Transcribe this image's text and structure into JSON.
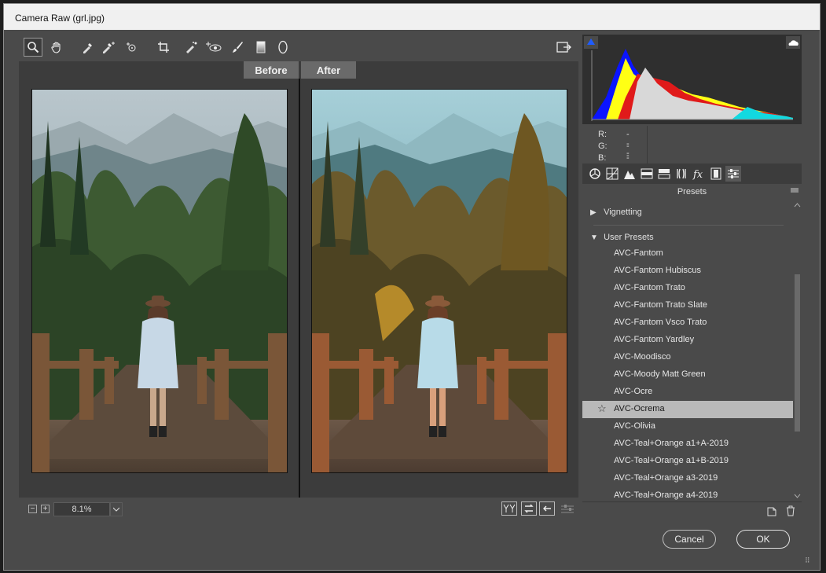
{
  "window": {
    "title": "Camera Raw (grl.jpg)"
  },
  "toolbar": {
    "tools": [
      "zoom-icon",
      "hand-icon",
      "white-balance-icon",
      "color-sampler-icon",
      "targeted-adjustment-icon",
      "crop-icon",
      "spot-removal-icon",
      "red-eye-icon",
      "adjustment-brush-icon",
      "graduated-filter-icon",
      "radial-filter-icon"
    ],
    "export_icon": "open-preferences-icon"
  },
  "preview": {
    "before_label": "Before",
    "after_label": "After"
  },
  "previewbar": {
    "zoom_out": "−",
    "zoom_in": "+",
    "zoom_value": "8.1%"
  },
  "histogram": {
    "r_label": "R:",
    "r_value": "---",
    "g_label": "G:",
    "g_value": "---",
    "b_label": "B:",
    "b_value": "---"
  },
  "panel_tabs": [
    "basic-icon",
    "tone-curve-icon",
    "detail-icon",
    "hsl-icon",
    "split-toning-icon",
    "lens-corrections-icon",
    "effects-icon",
    "camera-calibration-icon",
    "presets-icon"
  ],
  "presets": {
    "header": "Presets",
    "groups": [
      {
        "label": "Vignetting",
        "expanded": false
      },
      {
        "label": "User Presets",
        "expanded": true
      }
    ],
    "items": [
      "AVC-Fantom",
      "AVC-Fantom Hubiscus",
      "AVC-Fantom Trato",
      "AVC-Fantom Trato Slate",
      "AVC-Fantom Vsco Trato",
      "AVC-Fantom Yardley",
      "AVC-Moodisco",
      "AVC-Moody Matt Green",
      "AVC-Ocre",
      "AVC-Ocrema",
      "AVC-Olivia",
      "AVC-Teal+Orange a1+A-2019",
      "AVC-Teal+Orange a1+B-2019",
      "AVC-Teal+Orange a3-2019",
      "AVC-Teal+Orange a4-2019"
    ],
    "selected": "AVC-Ocrema"
  },
  "buttons": {
    "cancel": "Cancel",
    "ok": "OK"
  },
  "colors": {
    "accent_selected": "#b9b9b9",
    "panel_bg": "#4a4a4a",
    "preview_bg": "#3c3c3c"
  }
}
